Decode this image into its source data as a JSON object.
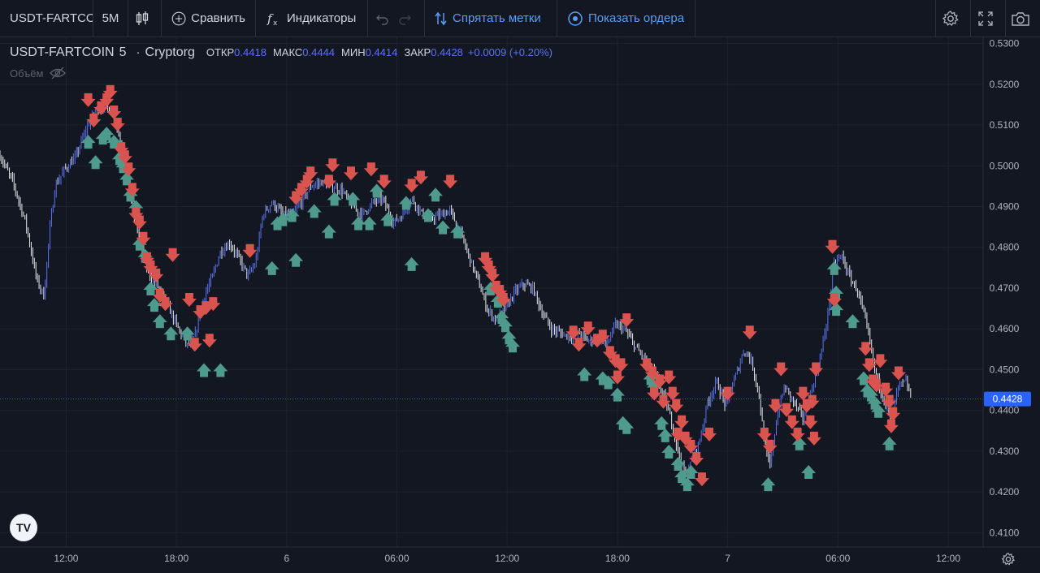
{
  "toolbar": {
    "symbol": "USDT-FARTCOIN",
    "interval": "5M",
    "compare_label": "Сравнить",
    "indicators_label": "Индикаторы",
    "hide_marks_label": "Спрятать метки",
    "show_orders_label": "Показать ордера",
    "icons": [
      "candles-icon",
      "plus-circle-icon",
      "fx-icon",
      "undo-icon",
      "redo-icon",
      "sort-arrows-icon",
      "target-icon",
      "gear-icon",
      "fullscreen-icon",
      "camera-icon"
    ]
  },
  "legend": {
    "title": "USDT-FARTCOIN",
    "interval": "5",
    "exchange": "Cryptorg",
    "open_label": "ОТКР",
    "open_value": "0.4418",
    "high_label": "МАКС",
    "high_value": "0.4444",
    "low_label": "МИН",
    "low_value": "0.4414",
    "close_label": "ЗАКР",
    "close_value": "0.4428",
    "change": "+0.0009 (+0.20%)",
    "volume_label": "Объём"
  },
  "logo_text": "TV",
  "colors": {
    "background": "#131722",
    "grid": "#1e222d",
    "up_candle": "#5b73f0",
    "down_candle": "#e6e8ef",
    "buy_arrow": "#4e9a8c",
    "sell_arrow": "#d9534f",
    "last_price_bg": "#2962ff"
  },
  "chart_data": {
    "type": "candlestick",
    "y_ticks": [
      "0.5300",
      "0.5200",
      "0.5100",
      "0.5000",
      "0.4900",
      "0.4800",
      "0.4700",
      "0.4600",
      "0.4500",
      "0.4400",
      "0.4300",
      "0.4200",
      "0.4100"
    ],
    "ylim": [
      0.4065,
      0.5315
    ],
    "x_ticks": [
      {
        "label": "12:00",
        "t": 0
      },
      {
        "label": "18:00",
        "t": 6
      },
      {
        "label": "6",
        "t": 12
      },
      {
        "label": "06:00",
        "t": 18
      },
      {
        "label": "12:00",
        "t": 24
      },
      {
        "label": "18:00",
        "t": 30
      },
      {
        "label": "7",
        "t": 36
      },
      {
        "label": "06:00",
        "t": 42
      },
      {
        "label": "12:00",
        "t": 48
      }
    ],
    "xlim": [
      -3.6,
      49.9
    ],
    "last_price": 0.4428,
    "last_price_label": "0.4428",
    "close_path": [
      [
        -3.6,
        0.5025
      ],
      [
        -2.9,
        0.496
      ],
      [
        -2.2,
        0.486
      ],
      [
        -1.6,
        0.472
      ],
      [
        -1.2,
        0.468
      ],
      [
        -0.9,
        0.484
      ],
      [
        -0.6,
        0.495
      ],
      [
        -0.1,
        0.499
      ],
      [
        0.5,
        0.502
      ],
      [
        1.0,
        0.508
      ],
      [
        1.4,
        0.512
      ],
      [
        1.9,
        0.515
      ],
      [
        2.3,
        0.514
      ],
      [
        2.7,
        0.511
      ],
      [
        3.1,
        0.502
      ],
      [
        3.5,
        0.492
      ],
      [
        3.9,
        0.484
      ],
      [
        4.3,
        0.476
      ],
      [
        4.7,
        0.472
      ],
      [
        5.2,
        0.469
      ],
      [
        5.7,
        0.464
      ],
      [
        6.1,
        0.46
      ],
      [
        6.6,
        0.456
      ],
      [
        7.0,
        0.458
      ],
      [
        7.5,
        0.468
      ],
      [
        7.9,
        0.472
      ],
      [
        8.4,
        0.479
      ],
      [
        8.9,
        0.481
      ],
      [
        9.3,
        0.478
      ],
      [
        9.9,
        0.473
      ],
      [
        10.3,
        0.476
      ],
      [
        10.7,
        0.488
      ],
      [
        11.2,
        0.491
      ],
      [
        11.8,
        0.488
      ],
      [
        12.3,
        0.488
      ],
      [
        12.8,
        0.491
      ],
      [
        13.3,
        0.495
      ],
      [
        13.9,
        0.496
      ],
      [
        14.4,
        0.495
      ],
      [
        15.0,
        0.494
      ],
      [
        15.6,
        0.49
      ],
      [
        16.1,
        0.488
      ],
      [
        16.7,
        0.491
      ],
      [
        17.2,
        0.492
      ],
      [
        17.8,
        0.486
      ],
      [
        18.3,
        0.488
      ],
      [
        18.8,
        0.492
      ],
      [
        19.4,
        0.488
      ],
      [
        19.9,
        0.487
      ],
      [
        20.4,
        0.488
      ],
      [
        20.9,
        0.489
      ],
      [
        21.5,
        0.483
      ],
      [
        21.9,
        0.478
      ],
      [
        22.4,
        0.472
      ],
      [
        22.9,
        0.465
      ],
      [
        23.4,
        0.462
      ],
      [
        23.9,
        0.465
      ],
      [
        24.4,
        0.469
      ],
      [
        24.9,
        0.471
      ],
      [
        25.4,
        0.47
      ],
      [
        25.9,
        0.464
      ],
      [
        26.4,
        0.46
      ],
      [
        26.9,
        0.459
      ],
      [
        27.4,
        0.458
      ],
      [
        27.9,
        0.459
      ],
      [
        28.4,
        0.457
      ],
      [
        28.9,
        0.458
      ],
      [
        29.4,
        0.456
      ],
      [
        29.9,
        0.461
      ],
      [
        30.4,
        0.46
      ],
      [
        30.9,
        0.456
      ],
      [
        31.4,
        0.453
      ],
      [
        31.9,
        0.45
      ],
      [
        32.4,
        0.445
      ],
      [
        32.9,
        0.438
      ],
      [
        33.3,
        0.43
      ],
      [
        33.7,
        0.424
      ],
      [
        34.1,
        0.428
      ],
      [
        34.5,
        0.433
      ],
      [
        34.9,
        0.442
      ],
      [
        35.4,
        0.447
      ],
      [
        35.9,
        0.441
      ],
      [
        36.4,
        0.448
      ],
      [
        36.9,
        0.455
      ],
      [
        37.3,
        0.452
      ],
      [
        37.7,
        0.444
      ],
      [
        38.0,
        0.432
      ],
      [
        38.3,
        0.426
      ],
      [
        38.7,
        0.439
      ],
      [
        39.1,
        0.446
      ],
      [
        39.6,
        0.442
      ],
      [
        40.1,
        0.438
      ],
      [
        40.5,
        0.444
      ],
      [
        41.0,
        0.452
      ],
      [
        41.4,
        0.462
      ],
      [
        41.8,
        0.476
      ],
      [
        42.2,
        0.478
      ],
      [
        42.6,
        0.473
      ],
      [
        43.1,
        0.469
      ],
      [
        43.6,
        0.46
      ],
      [
        44.0,
        0.45
      ],
      [
        44.4,
        0.444
      ],
      [
        44.9,
        0.438
      ],
      [
        45.3,
        0.446
      ],
      [
        45.7,
        0.447
      ],
      [
        46.0,
        0.4428
      ]
    ],
    "sell_markers": [
      [
        1.2,
        0.516
      ],
      [
        1.5,
        0.511
      ],
      [
        1.9,
        0.514
      ],
      [
        2.2,
        0.516
      ],
      [
        2.4,
        0.518
      ],
      [
        2.6,
        0.513
      ],
      [
        2.8,
        0.51
      ],
      [
        3.0,
        0.504
      ],
      [
        3.2,
        0.502
      ],
      [
        3.4,
        0.499
      ],
      [
        3.6,
        0.494
      ],
      [
        3.8,
        0.488
      ],
      [
        4.0,
        0.486
      ],
      [
        4.2,
        0.482
      ],
      [
        4.4,
        0.477
      ],
      [
        4.6,
        0.475
      ],
      [
        4.9,
        0.473
      ],
      [
        5.1,
        0.468
      ],
      [
        5.4,
        0.466
      ],
      [
        5.8,
        0.478
      ],
      [
        6.7,
        0.467
      ],
      [
        7.0,
        0.456
      ],
      [
        7.3,
        0.464
      ],
      [
        7.6,
        0.465
      ],
      [
        7.8,
        0.457
      ],
      [
        8.0,
        0.466
      ],
      [
        10.0,
        0.479
      ],
      [
        12.5,
        0.492
      ],
      [
        12.8,
        0.494
      ],
      [
        13.1,
        0.496
      ],
      [
        13.3,
        0.498
      ],
      [
        14.3,
        0.496
      ],
      [
        14.5,
        0.5
      ],
      [
        15.5,
        0.498
      ],
      [
        16.6,
        0.499
      ],
      [
        17.3,
        0.496
      ],
      [
        18.8,
        0.495
      ],
      [
        19.3,
        0.497
      ],
      [
        20.9,
        0.496
      ],
      [
        22.8,
        0.477
      ],
      [
        23.0,
        0.475
      ],
      [
        23.2,
        0.473
      ],
      [
        23.4,
        0.47
      ],
      [
        23.6,
        0.469
      ],
      [
        23.8,
        0.467
      ],
      [
        27.6,
        0.459
      ],
      [
        27.9,
        0.456
      ],
      [
        28.4,
        0.46
      ],
      [
        28.9,
        0.457
      ],
      [
        29.2,
        0.458
      ],
      [
        29.6,
        0.454
      ],
      [
        29.9,
        0.452
      ],
      [
        30.2,
        0.451
      ],
      [
        30.0,
        0.448
      ],
      [
        30.5,
        0.462
      ],
      [
        31.6,
        0.451
      ],
      [
        31.9,
        0.449
      ],
      [
        32.3,
        0.447
      ],
      [
        32.0,
        0.444
      ],
      [
        32.5,
        0.442
      ],
      [
        32.8,
        0.448
      ],
      [
        33.0,
        0.444
      ],
      [
        33.2,
        0.441
      ],
      [
        33.5,
        0.437
      ],
      [
        33.3,
        0.434
      ],
      [
        33.7,
        0.433
      ],
      [
        34.0,
        0.431
      ],
      [
        34.3,
        0.428
      ],
      [
        34.6,
        0.423
      ],
      [
        35.0,
        0.434
      ],
      [
        36.0,
        0.444
      ],
      [
        37.2,
        0.459
      ],
      [
        38.0,
        0.434
      ],
      [
        38.3,
        0.431
      ],
      [
        38.6,
        0.441
      ],
      [
        38.9,
        0.45
      ],
      [
        39.2,
        0.44
      ],
      [
        39.5,
        0.437
      ],
      [
        39.8,
        0.434
      ],
      [
        40.1,
        0.444
      ],
      [
        40.3,
        0.441
      ],
      [
        40.6,
        0.442
      ],
      [
        40.5,
        0.437
      ],
      [
        40.8,
        0.45
      ],
      [
        40.7,
        0.433
      ],
      [
        41.7,
        0.48
      ],
      [
        41.8,
        0.467
      ],
      [
        43.5,
        0.455
      ],
      [
        43.7,
        0.451
      ],
      [
        43.9,
        0.447
      ],
      [
        44.1,
        0.446
      ],
      [
        44.3,
        0.452
      ],
      [
        44.6,
        0.445
      ],
      [
        44.8,
        0.442
      ],
      [
        45.0,
        0.439
      ],
      [
        44.9,
        0.436
      ],
      [
        45.3,
        0.449
      ]
    ],
    "buy_markers": [
      [
        1.2,
        0.506
      ],
      [
        1.6,
        0.501
      ],
      [
        2.0,
        0.507
      ],
      [
        2.2,
        0.508
      ],
      [
        2.6,
        0.506
      ],
      [
        2.9,
        0.502
      ],
      [
        3.1,
        0.5
      ],
      [
        3.3,
        0.497
      ],
      [
        3.5,
        0.493
      ],
      [
        3.8,
        0.49
      ],
      [
        4.0,
        0.481
      ],
      [
        4.3,
        0.478
      ],
      [
        4.6,
        0.47
      ],
      [
        4.8,
        0.466
      ],
      [
        5.1,
        0.462
      ],
      [
        5.7,
        0.459
      ],
      [
        6.6,
        0.459
      ],
      [
        7.5,
        0.45
      ],
      [
        8.4,
        0.45
      ],
      [
        11.2,
        0.475
      ],
      [
        11.5,
        0.486
      ],
      [
        11.8,
        0.487
      ],
      [
        12.3,
        0.488
      ],
      [
        12.5,
        0.477
      ],
      [
        13.5,
        0.489
      ],
      [
        14.3,
        0.484
      ],
      [
        14.6,
        0.492
      ],
      [
        15.6,
        0.492
      ],
      [
        15.9,
        0.486
      ],
      [
        16.5,
        0.486
      ],
      [
        16.9,
        0.494
      ],
      [
        17.5,
        0.487
      ],
      [
        18.5,
        0.491
      ],
      [
        18.8,
        0.476
      ],
      [
        19.7,
        0.488
      ],
      [
        20.1,
        0.493
      ],
      [
        20.5,
        0.485
      ],
      [
        21.3,
        0.484
      ],
      [
        23.1,
        0.47
      ],
      [
        23.5,
        0.467
      ],
      [
        23.7,
        0.463
      ],
      [
        23.9,
        0.461
      ],
      [
        24.1,
        0.458
      ],
      [
        24.3,
        0.456
      ],
      [
        28.2,
        0.449
      ],
      [
        29.2,
        0.448
      ],
      [
        29.5,
        0.447
      ],
      [
        30.0,
        0.444
      ],
      [
        30.3,
        0.437
      ],
      [
        30.5,
        0.436
      ],
      [
        31.8,
        0.448
      ],
      [
        32.0,
        0.446
      ],
      [
        32.4,
        0.437
      ],
      [
        32.6,
        0.434
      ],
      [
        32.8,
        0.43
      ],
      [
        33.3,
        0.427
      ],
      [
        33.5,
        0.424
      ],
      [
        33.8,
        0.422
      ],
      [
        34.0,
        0.425
      ],
      [
        38.2,
        0.422
      ],
      [
        39.9,
        0.432
      ],
      [
        40.4,
        0.425
      ],
      [
        41.8,
        0.475
      ],
      [
        41.9,
        0.469
      ],
      [
        41.9,
        0.465
      ],
      [
        42.8,
        0.462
      ],
      [
        43.4,
        0.448
      ],
      [
        43.6,
        0.445
      ],
      [
        43.8,
        0.444
      ],
      [
        44.0,
        0.442
      ],
      [
        44.2,
        0.44
      ],
      [
        44.8,
        0.432
      ]
    ]
  }
}
